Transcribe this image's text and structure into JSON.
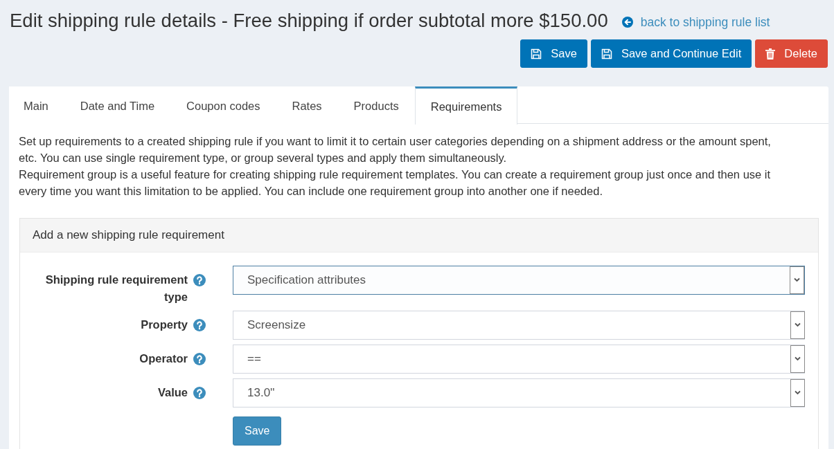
{
  "page": {
    "title": "Edit shipping rule details - Free shipping if order subtotal more $150.00",
    "back_link": "back to shipping rule list"
  },
  "actions": [
    {
      "label": "Save",
      "kind": "save"
    },
    {
      "label": "Save and Continue Edit",
      "kind": "save"
    },
    {
      "label": "Delete",
      "kind": "delete"
    }
  ],
  "tabs": [
    {
      "label": "Main",
      "selected": false
    },
    {
      "label": "Date and Time",
      "selected": false
    },
    {
      "label": "Coupon codes",
      "selected": false
    },
    {
      "label": "Rates",
      "selected": false
    },
    {
      "label": "Products",
      "selected": false
    },
    {
      "label": "Requirements",
      "selected": true
    }
  ],
  "description": [
    "Set up requirements to a created shipping rule if you want to limit it to certain user categories depending on a shipment address or the amount spent, etc. You can use single requirement type, or group several types and apply them simultaneously.",
    "Requirement group is a useful feature for creating shipping rule requirement templates. You can create a requirement group just once and then use it every time you want this limitation to be applied. You can include one requirement group into another one if needed."
  ],
  "requirement_panel": {
    "title": "Add a new shipping rule requirement",
    "fields": [
      {
        "label": "Shipping rule requirement type",
        "value": "Specification attributes",
        "focused": true
      },
      {
        "label": "Property",
        "value": "Screensize",
        "focused": false
      },
      {
        "label": "Operator",
        "value": "==",
        "focused": false
      },
      {
        "label": "Value",
        "value": "13.0''",
        "focused": false
      }
    ],
    "submit": "Save"
  }
}
